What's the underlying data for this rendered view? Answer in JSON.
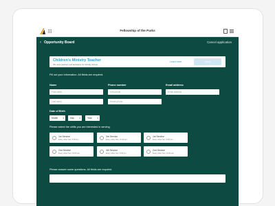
{
  "app": {
    "title": "Fellowship of the Parks"
  },
  "nav": {
    "title": "Opportunity Board",
    "cancel_label": "Cancel application"
  },
  "opportunity": {
    "title": "Children's Ministry Teacher",
    "subtitle": "We need teachers and assistants for Sunday School",
    "learn_more_label": "Learn more",
    "apply_label": "Apply"
  },
  "form": {
    "intro": "Fill out your information. All fields are required.",
    "name_label": "Name",
    "first_name_placeholder": "First name",
    "last_name_placeholder": "Last name",
    "phone_label": "Phone number",
    "phone_placeholder": "Cell phone",
    "home_phone_placeholder": "Home phone",
    "email_label": "Email address",
    "email_placeholder": "Email address",
    "dob_label": "Date of Birth",
    "month": "Month",
    "day": "Day",
    "year": "Year",
    "shifts_label": "Please select the shifts you are interested in serving.",
    "shifts": [
      {
        "name": "1st Service",
        "time": "Every other Sun, 8:30 am"
      },
      {
        "name": "3rd Service",
        "time": "Every other Sun, 11:30 am"
      },
      {
        "name": "1st Service",
        "time": "Every other Sun, 8:30 am"
      },
      {
        "name": "2nd Service",
        "time": "Every other Sun, 10:00 am"
      },
      {
        "name": "4th Service",
        "time": "Every other Sun, 5:00 pm"
      },
      {
        "name": "2nd Service",
        "time": "Every other Sun, 10:00 am"
      }
    ],
    "questions_label": "Please answer some questions. All fields are required."
  },
  "colors": {
    "background": "#0d4a42",
    "accent": "#2a9fd6"
  }
}
